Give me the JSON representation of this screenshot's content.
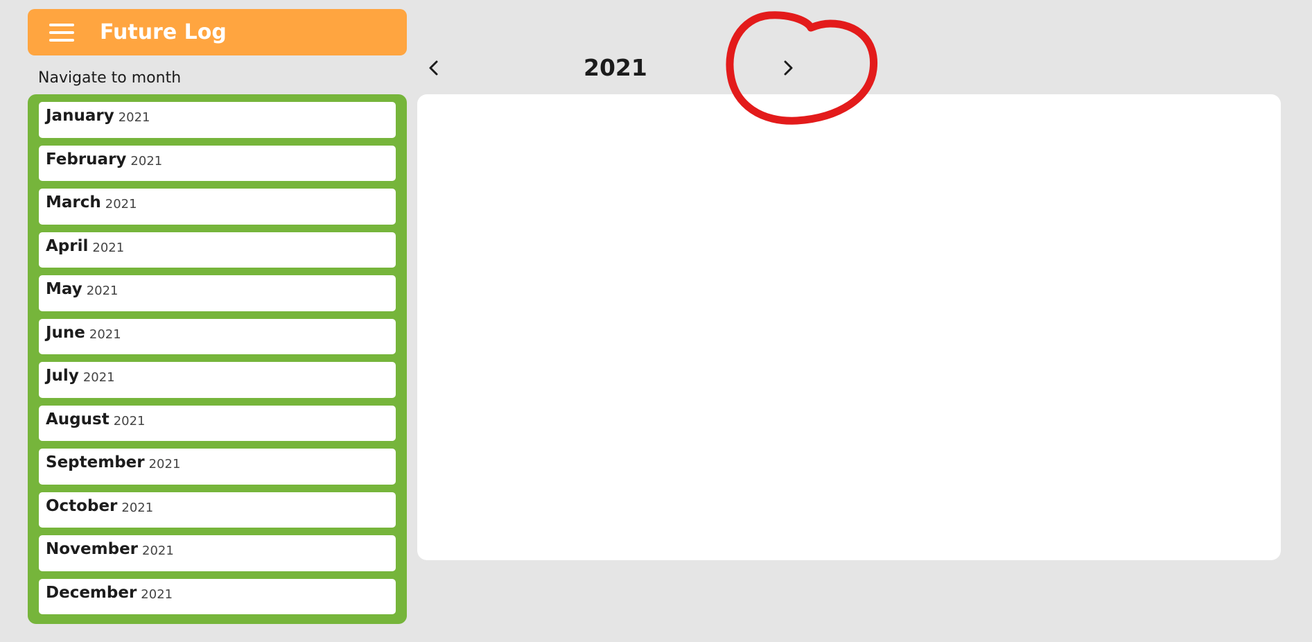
{
  "header": {
    "menu_icon": "hamburger-menu-icon",
    "title": "Future Log",
    "background_color": "#ffa540"
  },
  "sidebar": {
    "label": "Navigate to month",
    "background_color": "#76b53b",
    "months": [
      {
        "name": "January",
        "year": "2021"
      },
      {
        "name": "February",
        "year": "2021"
      },
      {
        "name": "March",
        "year": "2021"
      },
      {
        "name": "April",
        "year": "2021"
      },
      {
        "name": "May",
        "year": "2021"
      },
      {
        "name": "June",
        "year": "2021"
      },
      {
        "name": "July",
        "year": "2021"
      },
      {
        "name": "August",
        "year": "2021"
      },
      {
        "name": "September",
        "year": "2021"
      },
      {
        "name": "October",
        "year": "2021"
      },
      {
        "name": "November",
        "year": "2021"
      },
      {
        "name": "December",
        "year": "2021"
      }
    ]
  },
  "year_nav": {
    "prev_icon": "chevron-left-icon",
    "year": "2021",
    "next_icon": "chevron-right-icon"
  },
  "annotation": {
    "shape": "hand-drawn-circle",
    "color": "#e31b1b"
  }
}
